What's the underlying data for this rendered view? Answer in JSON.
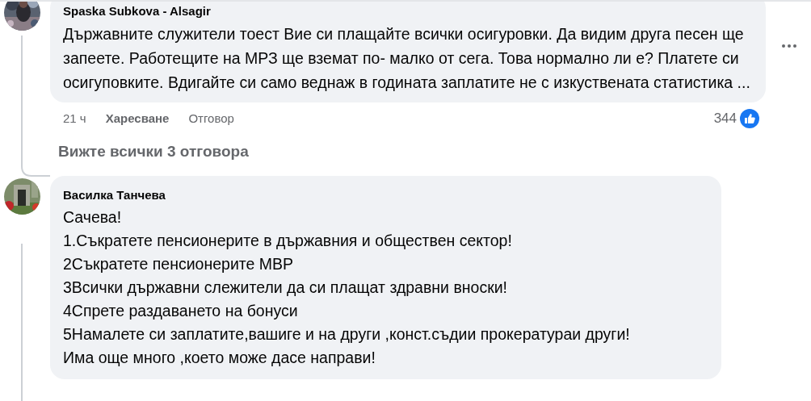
{
  "comments": [
    {
      "author": "Spaska Subkova - Alsagir",
      "text": "Държавните служители тоест Вие си плащайте всички осигуровки. Да видим друга песен ще запеете. Работещите на МРЗ ще вземат по- малко от сега. Това нормално ли е? Платете си осигуповките. Вдигайте си само веднаж в годината заплатите не с изкуствената статистика ...",
      "time": "21 ч",
      "like_label": "Харесване",
      "reply_label": "Отговор",
      "reaction_count": "344",
      "replies_link": "Вижте всички 3 отговора"
    },
    {
      "author": "Василка Танчева",
      "lines": [
        "Сачева!",
        "1.Съкратете пенсионерите в държавния и обществен сектор!",
        "2Съкратете пенсионерите МВР",
        "3Всички държавни слежители да си плащат здравни вноски!",
        "4Спрете раздаването на бонуси",
        "5Намалете си заплатите,вашиге и на други ,конст.съдии прокератураи други!",
        "Има още много ,което може дасе направи!"
      ]
    }
  ]
}
